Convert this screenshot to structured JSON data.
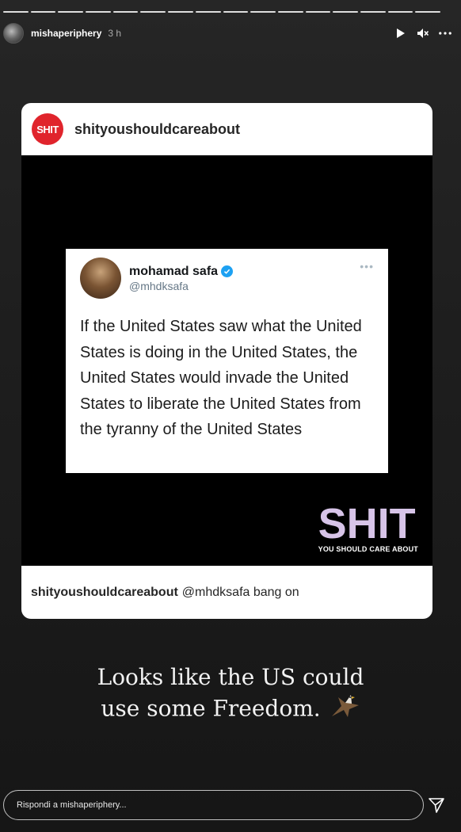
{
  "story": {
    "progress_segments": 16,
    "username": "mishaperiphery",
    "time": "3 h"
  },
  "post": {
    "account": "shityoushouldcareabout",
    "logo_text": "SHIT",
    "tweet": {
      "name": "mohamad safa",
      "handle": "@mhdksafa",
      "more": "•••",
      "text": "If the United States saw what the United States is doing in the United States, the United States would invade the United States to liberate the United States from the tyranny of the United States"
    },
    "brand": {
      "big": "SHIT",
      "small": "YOU SHOULD CARE ABOUT"
    },
    "caption": {
      "user": "shityoushouldcareabout",
      "text": "@mhdksafa bang on"
    }
  },
  "story_text": {
    "line1": "Looks like the US could",
    "line2": "use some Freedom."
  },
  "reply": {
    "placeholder": "Rispondi a mishaperiphery..."
  },
  "icons": [
    "play-icon",
    "mute-icon",
    "more-icon",
    "verified-icon",
    "eagle-icon",
    "send-icon"
  ],
  "colors": {
    "logo_red": "#e0242c",
    "brand_lavender": "#d7c4e8",
    "verified_blue": "#1da1f2"
  }
}
